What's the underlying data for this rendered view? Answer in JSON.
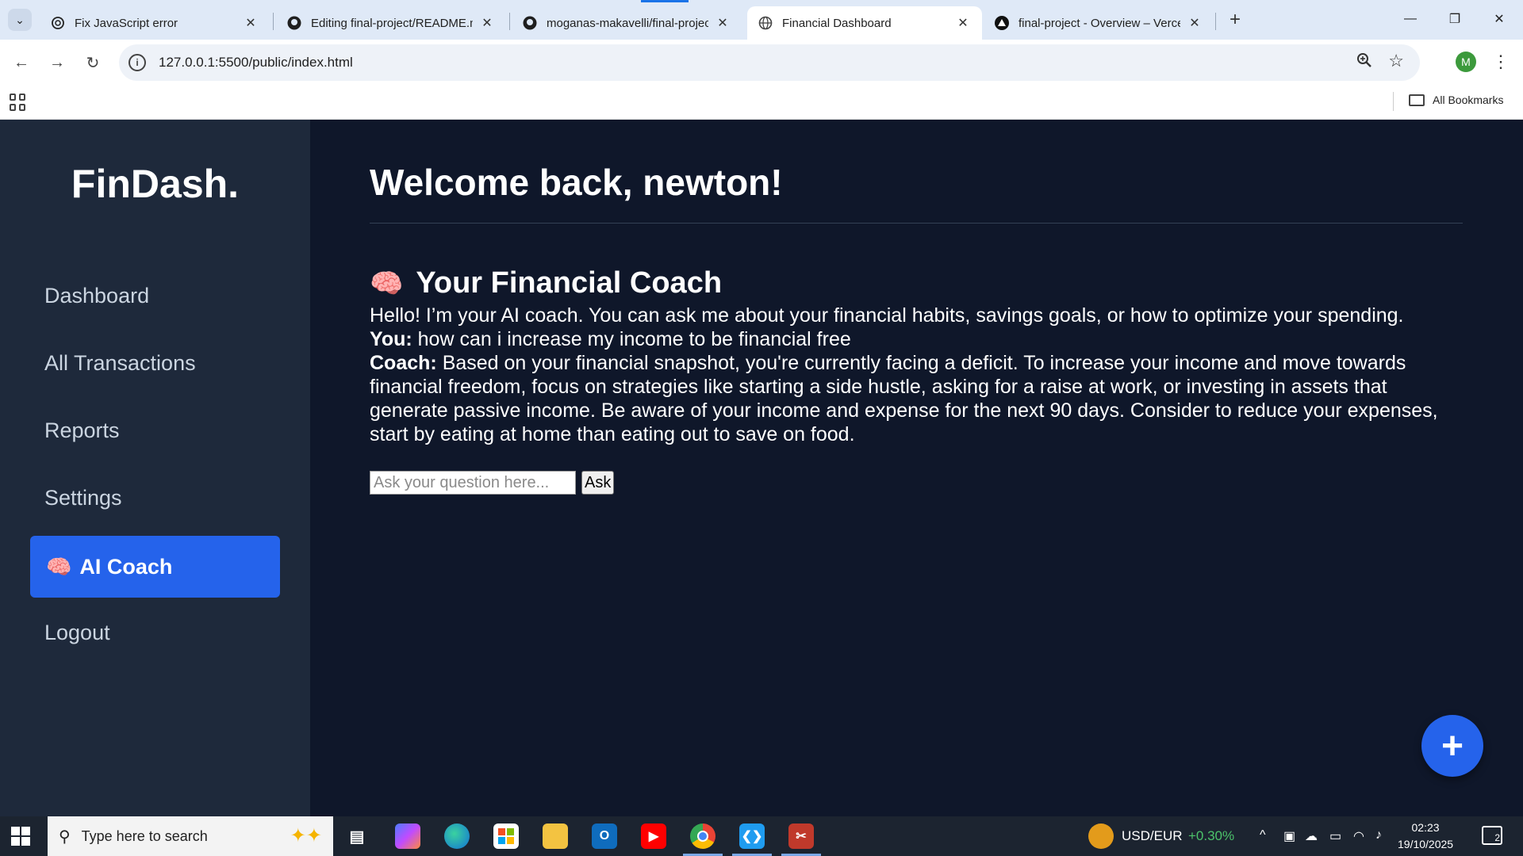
{
  "browser": {
    "tabs": [
      {
        "title": "Fix JavaScript error",
        "icon": "openai-icon",
        "active": false
      },
      {
        "title": "Editing final-project/README.m",
        "icon": "github-icon",
        "active": false
      },
      {
        "title": "moganas-makavelli/final-projec",
        "icon": "github-icon",
        "active": false
      },
      {
        "title": "Financial Dashboard",
        "icon": "globe-icon",
        "active": true
      },
      {
        "title": "final-project - Overview – Verce",
        "icon": "vercel-icon",
        "active": false
      }
    ],
    "url": "127.0.0.1:5500/public/index.html",
    "profile_initial": "M",
    "bookmarks_label": "All Bookmarks"
  },
  "sidebar": {
    "brand": "FinDash.",
    "items": [
      {
        "label": "Dashboard",
        "active": false
      },
      {
        "label": "All Transactions",
        "active": false
      },
      {
        "label": "Reports",
        "active": false
      },
      {
        "label": "Settings",
        "active": false
      },
      {
        "label": "AI Coach",
        "active": true,
        "icon": "🧠"
      },
      {
        "label": "Logout",
        "active": false
      }
    ]
  },
  "main": {
    "welcome": "Welcome back, newton!",
    "coach": {
      "icon": "🧠",
      "title": "Your Financial Coach",
      "intro": "Hello! I’m your AI coach. You can ask me about your financial habits, savings goals, or how to optimize your spending.",
      "user_label": "You:",
      "user_message": "how can i increase my income to be financial free",
      "coach_label": "Coach:",
      "coach_message": "Based on your financial snapshot, you're currently facing a deficit. To increase your income and move towards financial freedom, focus on strategies like starting a side hustle, asking for a raise at work, or investing in assets that generate passive income. Be aware of your income and expense for the next 90 days. Consider to reduce your expenses, start by eating at home than eating out to save on food.",
      "input_placeholder": "Ask your question here...",
      "ask_label": "Ask"
    },
    "fab_label": "+"
  },
  "taskbar": {
    "search_placeholder": "Type here to search",
    "ticker_label": "USD/EUR",
    "ticker_change": "+0.30%",
    "time": "02:23",
    "date": "19/10/2025",
    "notification_count": "2"
  },
  "colors": {
    "page_bg": "#0f172a",
    "sidebar_bg": "#1e293b",
    "accent": "#2563eb"
  }
}
